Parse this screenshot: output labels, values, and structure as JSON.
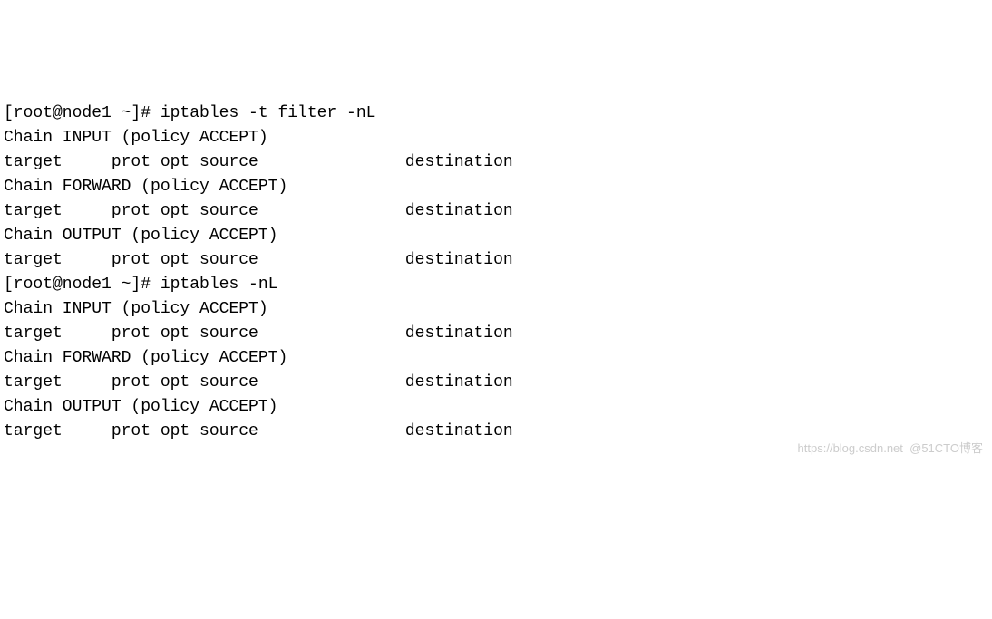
{
  "lines": [
    "[root@node1 ~]# iptables -t filter -nL",
    "Chain INPUT (policy ACCEPT)",
    "target     prot opt source               destination",
    "",
    "Chain FORWARD (policy ACCEPT)",
    "target     prot opt source               destination",
    "",
    "Chain OUTPUT (policy ACCEPT)",
    "target     prot opt source               destination",
    "[root@node1 ~]# iptables -nL",
    "Chain INPUT (policy ACCEPT)",
    "target     prot opt source               destination",
    "",
    "Chain FORWARD (policy ACCEPT)",
    "target     prot opt source               destination",
    "",
    "Chain OUTPUT (policy ACCEPT)",
    "target     prot opt source               destination"
  ],
  "watermark": "https://blog.csdn.net  @51CTO博客"
}
